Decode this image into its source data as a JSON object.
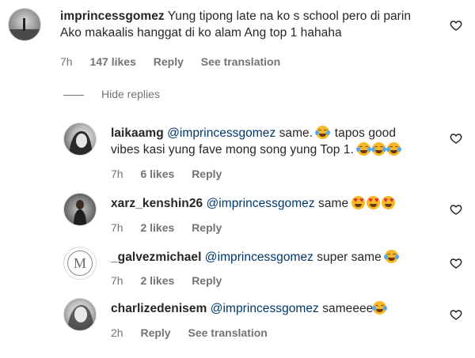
{
  "comments": [
    {
      "username": "imprincessgomez",
      "text": "Yung tipong late na ko s school pero di parin Ako makaalis hanggat di ko alam Ang top 1 hahaha",
      "time": "7h",
      "likes": "147 likes",
      "reply": "Reply",
      "translation": "See translation"
    },
    {
      "username": "laikaamg",
      "mention": "@imprincessgomez",
      "text_before": "same.",
      "text_after": "tapos good vibes kasi yung fave mong song yung Top 1.",
      "time": "7h",
      "likes": "6 likes",
      "reply": "Reply"
    },
    {
      "username": "xarz_kenshin26",
      "mention": "@imprincessgomez",
      "text": "same",
      "time": "7h",
      "likes": "2 likes",
      "reply": "Reply"
    },
    {
      "username": "_galvezmichael",
      "mention": "@imprincessgomez",
      "text": "super same",
      "avatar_letter": "M",
      "time": "7h",
      "likes": "2 likes",
      "reply": "Reply"
    },
    {
      "username": "charlizedenisem",
      "mention": "@imprincessgomez",
      "text": "sameeee",
      "time": "2h",
      "reply": "Reply",
      "translation": "See translation"
    }
  ],
  "hide_replies": "Hide replies",
  "icons": {
    "like": "heart-outline-icon",
    "emoji_laugh": "grinning-squinting-face",
    "emoji_heart_eyes": "smiling-face-with-heart-eyes"
  },
  "colors": {
    "text": "#262626",
    "secondary": "#737373",
    "mention": "#00376b"
  }
}
